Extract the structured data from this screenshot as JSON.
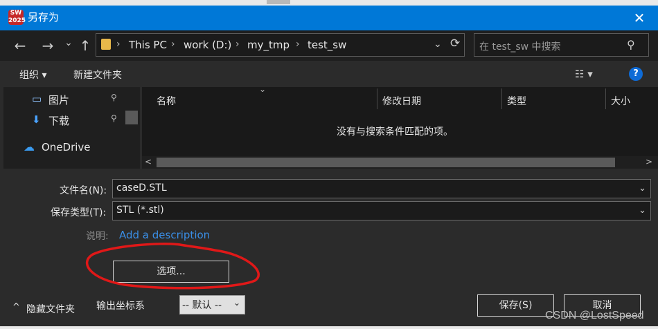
{
  "window": {
    "title": "另存为",
    "logo_text": "SW 2025",
    "close_glyph": "✕"
  },
  "nav": {
    "back": "←",
    "forward": "→",
    "history_drop": "⌄",
    "up": "↑",
    "breadcrumbs": [
      "This PC",
      "work (D:)",
      "my_tmp",
      "test_sw"
    ],
    "sep": "›",
    "address_drop": "⌄",
    "refresh": "⟳",
    "search_placeholder": "在 test_sw 中搜索",
    "search_glyph": "⚲"
  },
  "toolbar": {
    "organize": "组织 ▾",
    "new_folder": "新建文件夹",
    "view_glyph": "☷ ▾",
    "help_glyph": "?"
  },
  "nav_pane": {
    "items": [
      {
        "label": "图片",
        "icon": "▭"
      },
      {
        "label": "下载",
        "icon": "⬇"
      },
      {
        "label": "OneDrive",
        "icon": "☁"
      }
    ],
    "pin_glyph": "📌"
  },
  "file_list": {
    "columns": [
      "名称",
      "修改日期",
      "类型",
      "大小"
    ],
    "sort_glyph": "⌄",
    "empty_message": "没有与搜索条件匹配的项。",
    "scroll_left": "<",
    "scroll_right": ">"
  },
  "form": {
    "filename_label": "文件名(N):",
    "filename_value": "caseD.STL",
    "type_label": "保存类型(T):",
    "type_value": "STL (*.stl)",
    "dropdown_glyph": "⌄",
    "desc_label": "说明:",
    "desc_link": "Add a description",
    "options_button": "选项...",
    "hide_folders": "隐藏文件夹",
    "hide_glyph": "^",
    "coord_label": "输出坐标系",
    "coord_value": "-- 默认 --",
    "save_button": "保存(S)",
    "cancel_button": "取消"
  },
  "watermark": "CSDN @LostSpeed",
  "colors": {
    "titlebar": "#0078d7",
    "annotation": "#e01818",
    "link": "#3a8ee6"
  }
}
